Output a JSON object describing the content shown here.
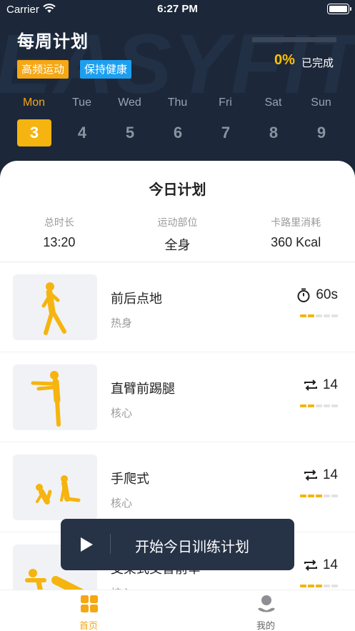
{
  "status_bar": {
    "carrier": "Carrier",
    "time": "6:27 PM"
  },
  "header": {
    "watermark": "EASYFIT",
    "title": "每周计划",
    "tags": [
      "高频运动",
      "保持健康"
    ],
    "progress": {
      "percent_text": "0%",
      "label": "已完成",
      "fraction": 0
    }
  },
  "week": {
    "days": [
      {
        "name": "Mon",
        "num": "3",
        "active": true
      },
      {
        "name": "Tue",
        "num": "4",
        "active": false
      },
      {
        "name": "Wed",
        "num": "5",
        "active": false
      },
      {
        "name": "Thu",
        "num": "6",
        "active": false
      },
      {
        "name": "Fri",
        "num": "7",
        "active": false
      },
      {
        "name": "Sat",
        "num": "8",
        "active": false
      },
      {
        "name": "Sun",
        "num": "9",
        "active": false
      }
    ]
  },
  "plan": {
    "title": "今日计划",
    "stats": [
      {
        "label": "总时长",
        "value": "13:20"
      },
      {
        "label": "运动部位",
        "value": "全身"
      },
      {
        "label": "卡路里消耗",
        "value": "360 Kcal"
      }
    ],
    "exercises": [
      {
        "name": "前后点地",
        "category": "热身",
        "metric_icon": "stopwatch-icon",
        "metric": "60s",
        "level": 2,
        "level_max": 5
      },
      {
        "name": "直臂前踢腿",
        "category": "核心",
        "metric_icon": "repeat-icon",
        "metric": "14",
        "level": 2,
        "level_max": 5
      },
      {
        "name": "手爬式",
        "category": "核心",
        "metric_icon": "repeat-icon",
        "metric": "14",
        "level": 3,
        "level_max": 5
      },
      {
        "name": "支架式交替前举",
        "category": "核心",
        "metric_icon": "repeat-icon",
        "metric": "14",
        "level": 3,
        "level_max": 5
      }
    ]
  },
  "start_button": {
    "label": "开始今日训练计划",
    "icon": "play-icon"
  },
  "tabbar": {
    "tabs": [
      {
        "label": "首页",
        "icon": "home-grid-icon",
        "active": true
      },
      {
        "label": "我的",
        "icon": "profile-icon",
        "active": false
      }
    ]
  },
  "colors": {
    "accent": "#f5a714",
    "header_bg": "#1c2739",
    "tag_blue": "#1d9ff0",
    "button_bg": "#263347"
  }
}
